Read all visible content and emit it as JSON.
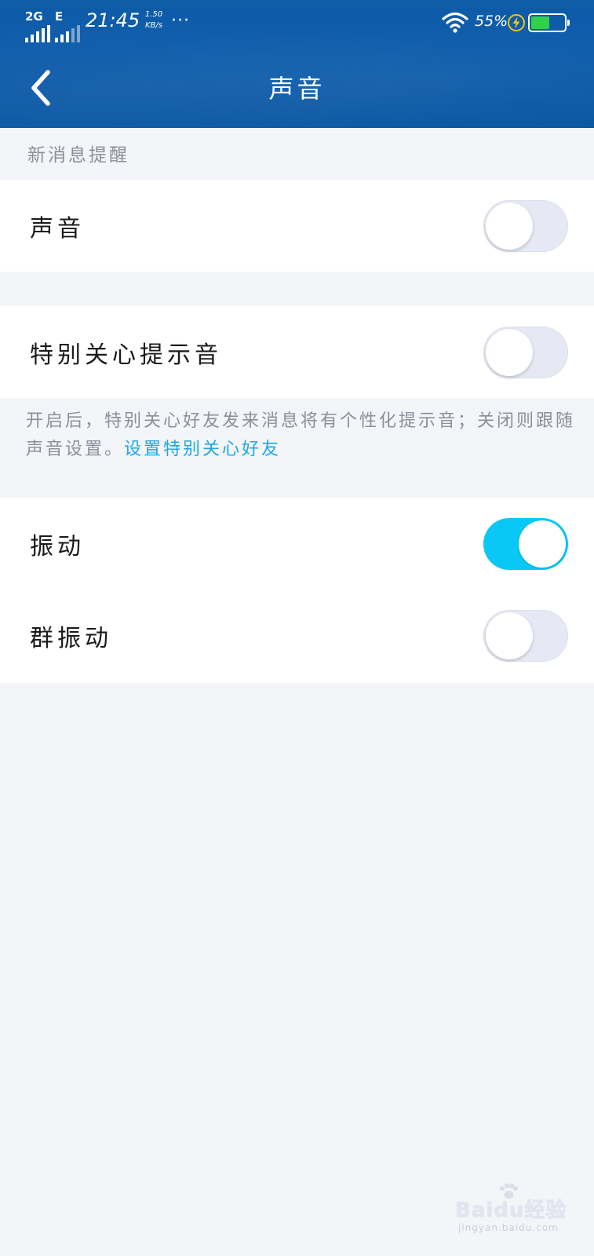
{
  "status_bar": {
    "network_1": "2G",
    "network_2": "E",
    "time": "21:45",
    "speed_value": "1.50",
    "speed_unit": "KB/s",
    "more": "···",
    "battery_percent": "55%",
    "battery_level": 0.55,
    "battery_color": "#2fd04a"
  },
  "header": {
    "title": "声音",
    "back_icon": "chevron-left-icon",
    "background": "#0c5bab"
  },
  "section": {
    "label": "新消息提醒"
  },
  "settings": {
    "sound": {
      "label": "声音",
      "on": false
    },
    "special_care_tone": {
      "label": "特别关心提示音",
      "on": false
    },
    "vibrate": {
      "label": "振动",
      "on": true
    },
    "group_vibrate": {
      "label": "群振动",
      "on": false
    }
  },
  "note": {
    "text": "开启后，特别关心好友发来消息将有个性化提示音；关闭则跟随声音设置。",
    "link": "设置特别关心好友"
  },
  "colors": {
    "toggle_on": "#0ac8f5",
    "toggle_off": "#e6e9f3",
    "link": "#1ea6e6",
    "page_bg": "#f3f5f9"
  },
  "watermark": {
    "main": "Baidu经验",
    "sub": "jingyan.baidu.com"
  }
}
